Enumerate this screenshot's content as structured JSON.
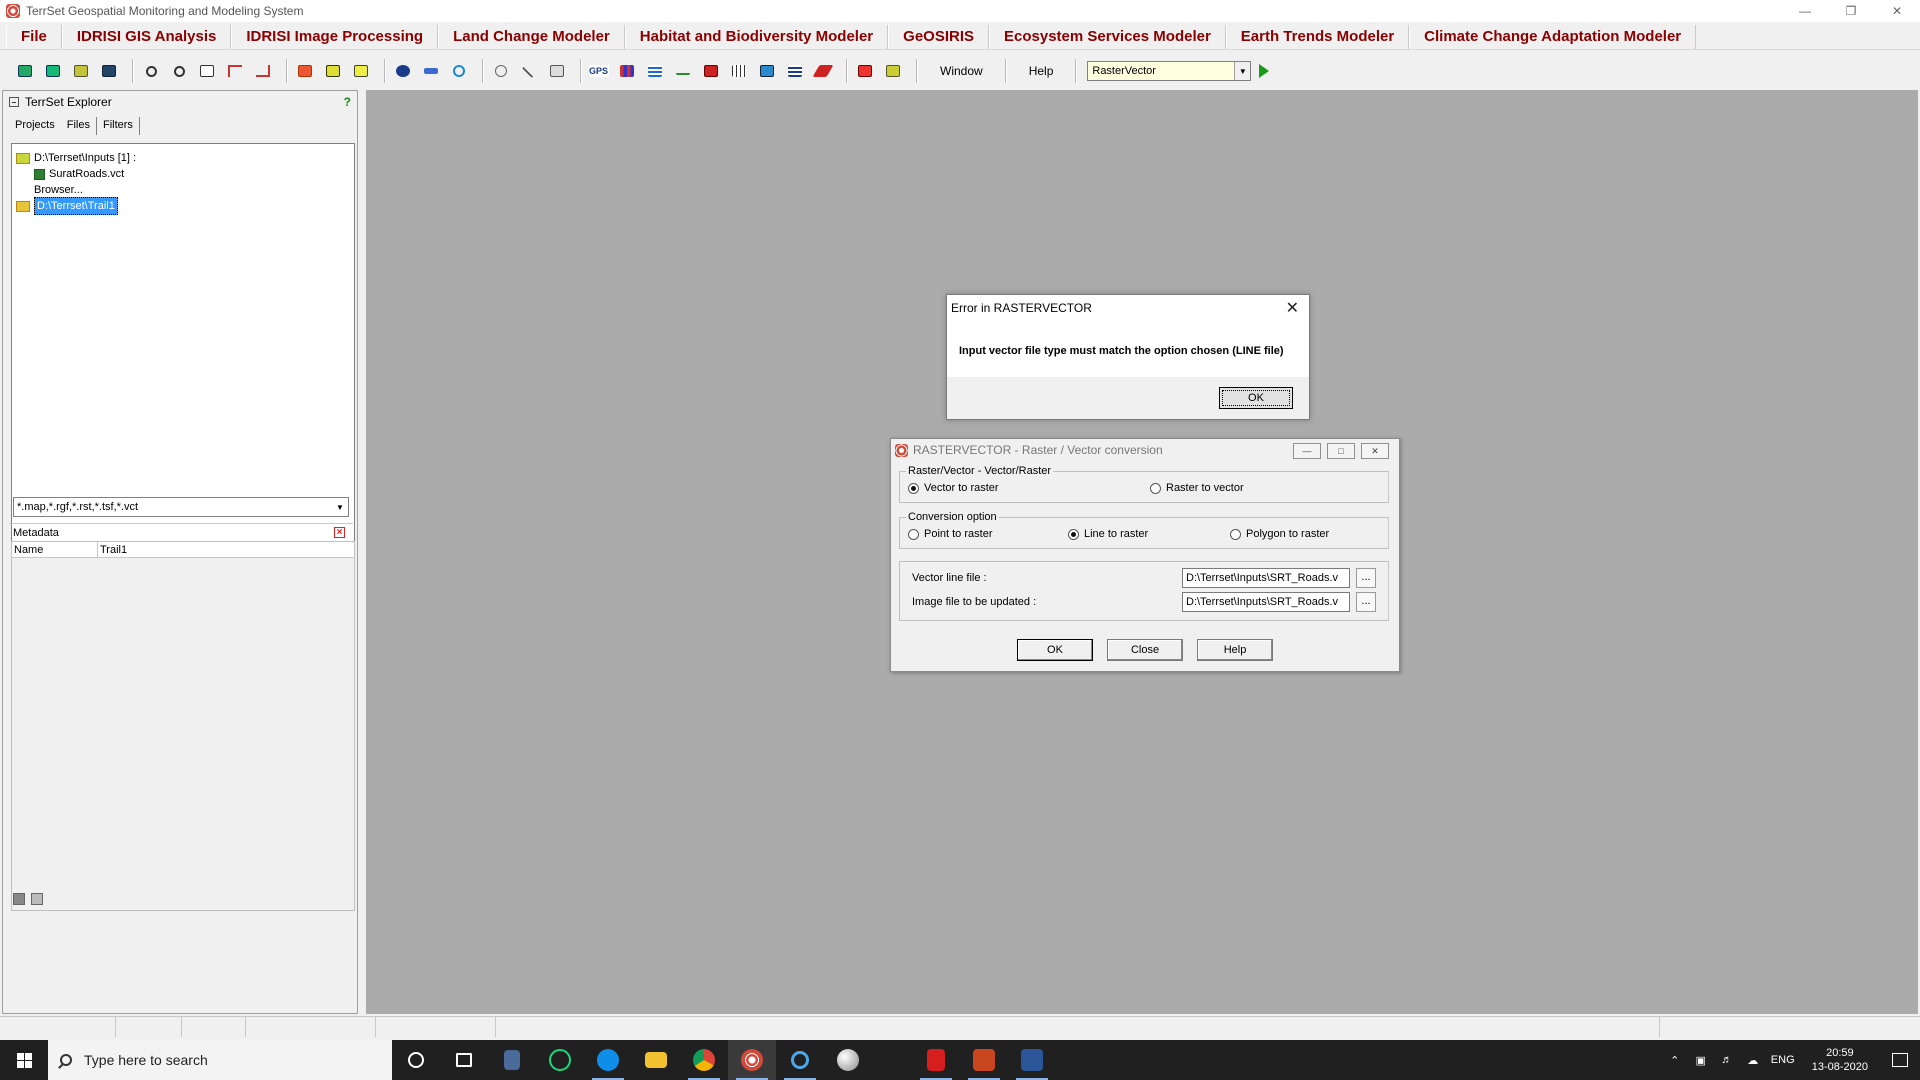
{
  "window": {
    "title": "TerrSet Geospatial Monitoring and Modeling System"
  },
  "menu": [
    "File",
    "IDRISI  GIS Analysis",
    "IDRISI  Image Processing",
    "Land Change Modeler",
    "Habitat and Biodiversity Modeler",
    "GeOSIRIS",
    "Ecosystem Services Modeler",
    "Earth Trends Modeler",
    "Climate Change Adaptation Modeler"
  ],
  "toolbar": {
    "window_label": "Window",
    "help_label": "Help",
    "module_value": "RasterVector"
  },
  "explorer": {
    "title": "TerrSet Explorer",
    "help_icon": "?",
    "tabs": [
      "Projects",
      "Files",
      "Filters"
    ],
    "tree": {
      "folder1": "D:\\Terrset\\Inputs [1] :",
      "file1": "SuratRoads.vct",
      "browse": "Browser...",
      "folder2": "D:\\Terrset\\Trail1"
    },
    "filter": "*.map,*.rgf,*.rst,*.tsf,*.vct",
    "metadata": {
      "title": "Metadata",
      "col_name": "Name",
      "col_value": "Trail1"
    }
  },
  "error_dialog": {
    "title": "Error in RASTERVECTOR",
    "message": "Input vector file type must match the option chosen (LINE file)",
    "ok": "OK",
    "close_glyph": "✕"
  },
  "rv_dialog": {
    "title": "RASTERVECTOR - Raster / Vector conversion",
    "group1_label": "Raster/Vector - Vector/Raster",
    "opt_vector_to_raster": "Vector to raster",
    "opt_raster_to_vector": "Raster to vector",
    "group2_label": "Conversion option",
    "opt_point": "Point to raster",
    "opt_line": "Line to raster",
    "opt_polygon": "Polygon to raster",
    "vector_label": "Vector line file :",
    "vector_value": "D:\\Terrset\\Inputs\\SRT_Roads.v",
    "image_label": "Image file to be updated :",
    "image_value": "D:\\Terrset\\Inputs\\SRT_Roads.v",
    "browse": "...",
    "ok": "OK",
    "close": "Close",
    "help": "Help",
    "selected_direction": "Vector to raster",
    "selected_option": "Line to raster"
  },
  "taskbar": {
    "search_placeholder": "Type here to search",
    "lang": "ENG",
    "time": "20:59",
    "date": "13-08-2020"
  }
}
